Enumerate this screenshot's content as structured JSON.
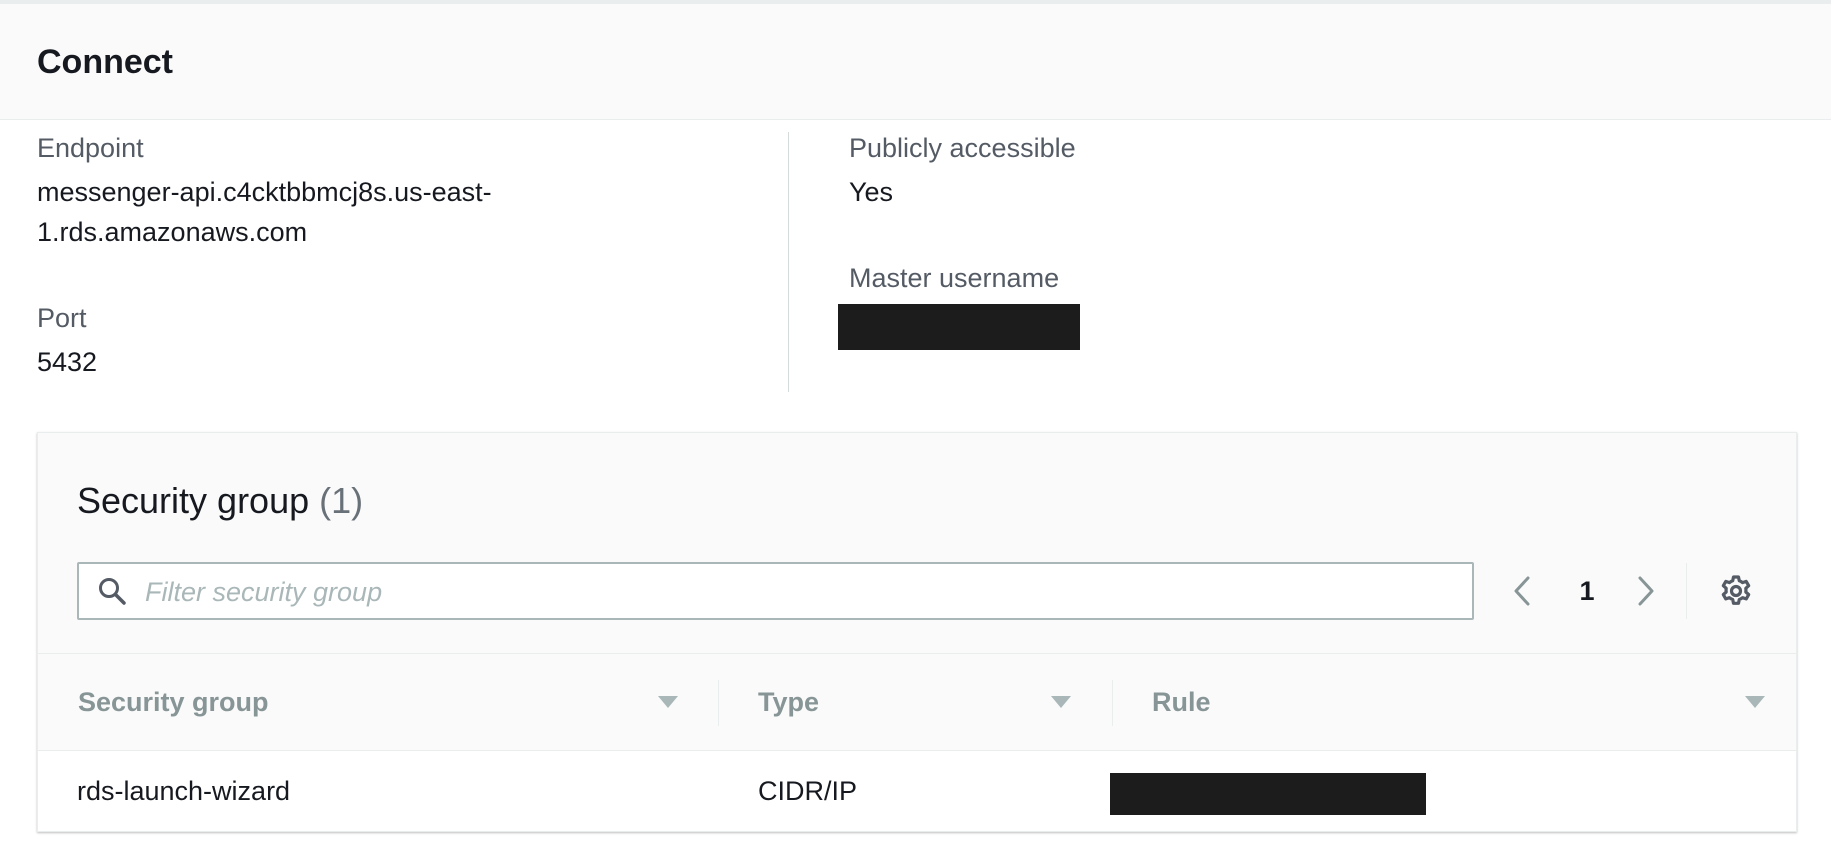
{
  "header": {
    "title": "Connect"
  },
  "details": {
    "endpoint": {
      "label": "Endpoint",
      "value_line1": "messenger-api.c4cktbbmcj8s.us-east-",
      "value_line2": "1.rds.amazonaws.com"
    },
    "port": {
      "label": "Port",
      "value": "5432"
    },
    "publicly_accessible": {
      "label": "Publicly accessible",
      "value": "Yes"
    },
    "master_username": {
      "label": "Master username"
    }
  },
  "security_group_panel": {
    "title": "Security group",
    "count": "(1)",
    "filter": {
      "placeholder": "Filter security group",
      "value": ""
    },
    "pagination": {
      "current_page": "1"
    },
    "columns": [
      "Security group",
      "Type",
      "Rule"
    ],
    "rows": [
      {
        "security_group": "rds-launch-wizard",
        "type": "CIDR/IP"
      }
    ]
  },
  "icons": {
    "search": "search-icon",
    "prev": "chevron-left-icon",
    "next": "chevron-right-icon",
    "settings": "gear-icon",
    "sort": "caret-down-icon"
  },
  "colors": {
    "header_bg": "#fafafa",
    "panel_bg": "#fafafa",
    "redaction": "#1c1c1c",
    "muted_text": "#545b64",
    "column_header_text": "#879596"
  }
}
